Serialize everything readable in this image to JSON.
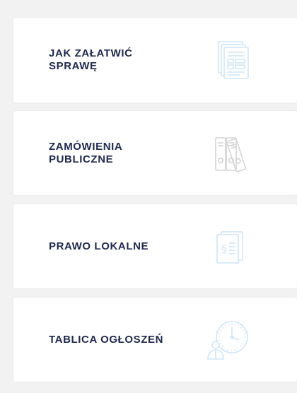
{
  "tiles": [
    {
      "label": "JAK ZAŁATWIĆ\nSPRAWĘ",
      "icon": "documents-icon",
      "icon_color": "#cfe6f7"
    },
    {
      "label": "ZAMÓWIENIA\nPUBLICZNE",
      "icon": "binders-icon",
      "icon_color": "#d4d4d4"
    },
    {
      "label": "PRAWO LOKALNE",
      "icon": "law-paragraph-document-icon",
      "icon_color": "#cfe6f7"
    },
    {
      "label": "TABLICA OGŁOSZEŃ",
      "icon": "clock-person-icon",
      "icon_color": "#cfe6f7"
    }
  ],
  "colors": {
    "page_background": "#f2f2f2",
    "tile_background": "#ffffff",
    "label_text": "#20294f"
  }
}
